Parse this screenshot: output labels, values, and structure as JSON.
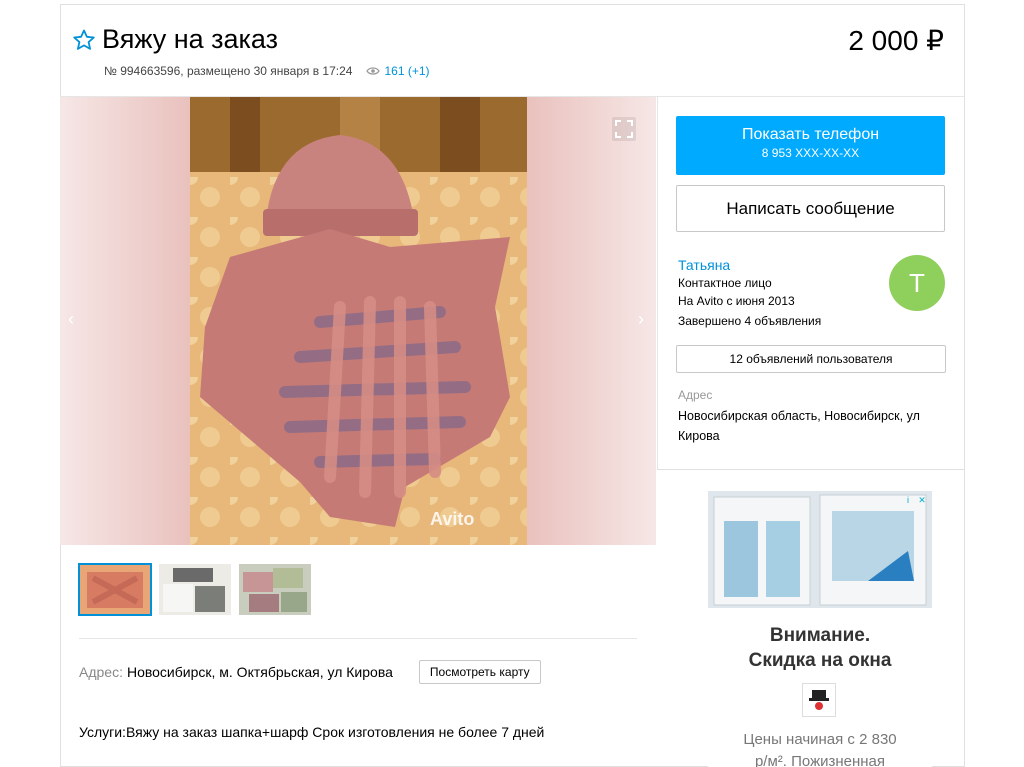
{
  "listing": {
    "title": "Вяжу на заказ",
    "price": "2 000 ₽",
    "meta": "№ 994663596, размещено 30 января в 17:24",
    "views": "161 (+1)"
  },
  "gallery": {
    "watermark": "Avito",
    "prev_arrow": "‹",
    "next_arrow": "›",
    "thumbnails": [
      "thumbnail-1",
      "thumbnail-2",
      "thumbnail-3"
    ]
  },
  "details": {
    "address_label": "Адрес:",
    "address_value": "Новосибирск, м. Октябрьская, ул Кирова",
    "map_button": "Посмотреть карту",
    "services": "Услуги:Вяжу на заказ шапка+шарф Срок изготовления не более 7 дней"
  },
  "sidebar": {
    "phone_button_label": "Показать телефон",
    "phone_number": "8 953 XXX-XX-XX",
    "message_button": "Написать сообщение",
    "seller_name": "Татьяна",
    "seller_role": "Контактное лицо",
    "seller_since": "На Avito с июня 2013",
    "seller_completed": "Завершено 4 объявления",
    "avatar_letter": "Т",
    "listings_button": "12 объявлений пользователя",
    "address_label": "Адрес",
    "address_value": "Новосибирская область, Новосибирск, ул Кирова"
  },
  "ad": {
    "title_line1": "Внимание.",
    "title_line2": "Скидка на окна",
    "text_line1": "Цены начиная с 2 830",
    "text_line2": "р/м². Пожизненная"
  },
  "colors": {
    "accent": "#00aaff",
    "link": "#0091d9",
    "avatar": "#8fcf5c"
  }
}
